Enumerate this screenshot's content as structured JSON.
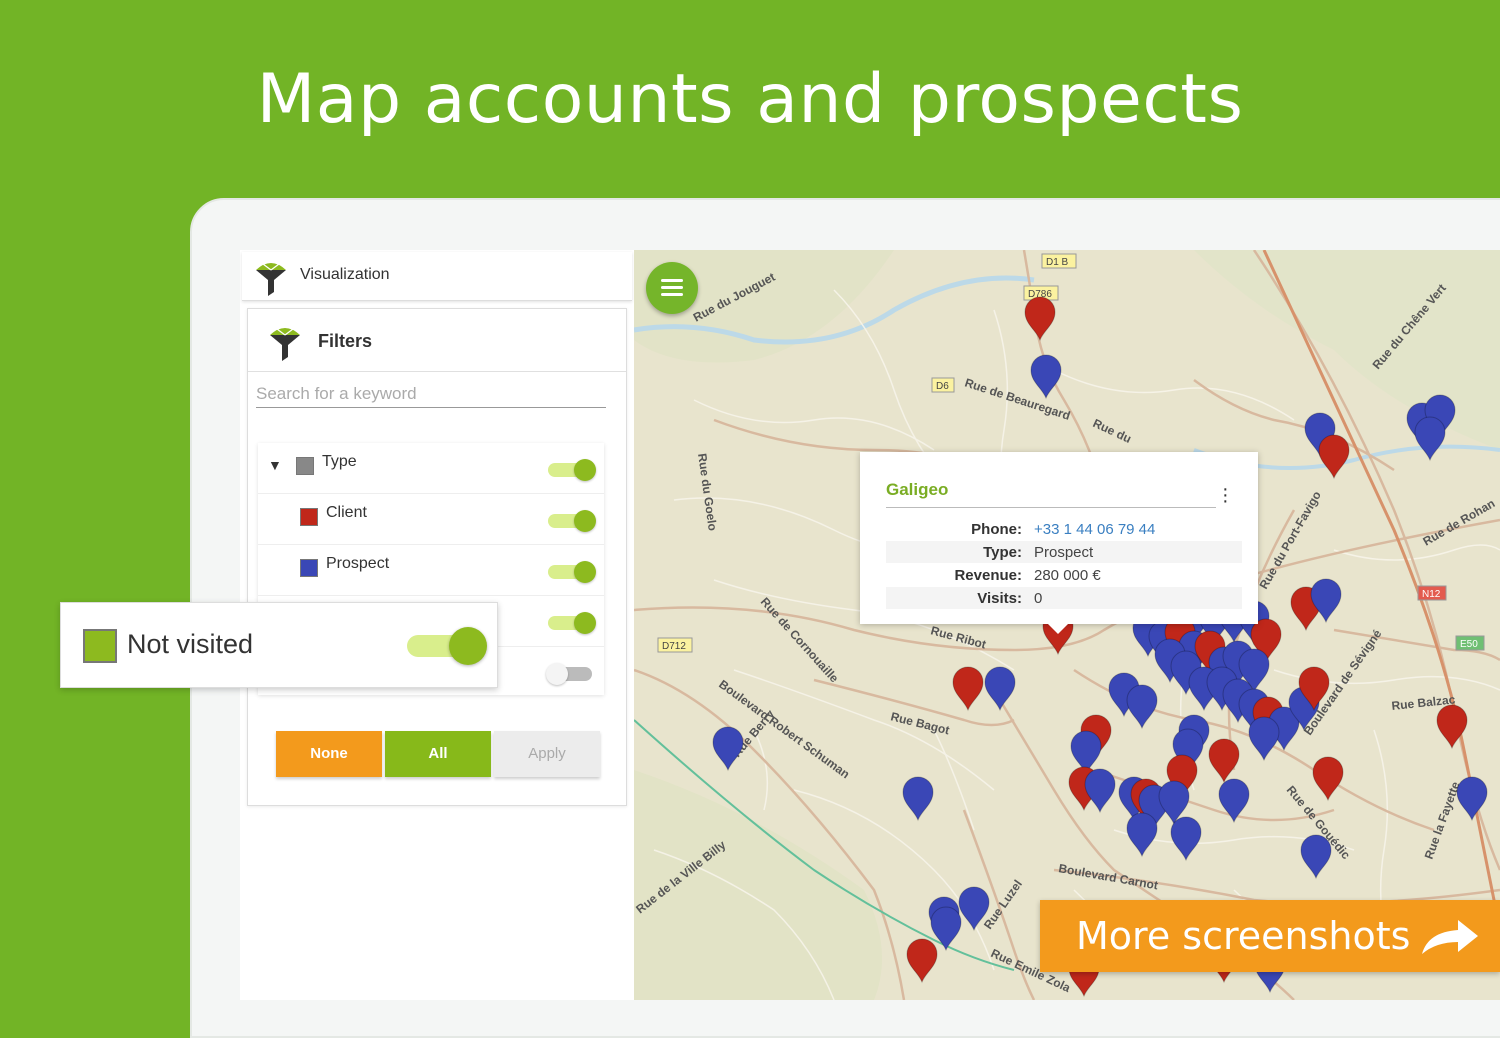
{
  "headline": "Map accounts and prospects",
  "sidebar": {
    "panel_title": "Visualization",
    "filters_title": "Filters",
    "search_placeholder": "Search for a keyword",
    "tree": [
      {
        "label": "Type",
        "color": "#888888",
        "enabled": true
      },
      {
        "label": "Client",
        "color": "#c0271a",
        "enabled": true
      },
      {
        "label": "Prospect",
        "color": "#3a47b6",
        "enabled": true
      },
      {
        "label": "",
        "enabled": true
      },
      {
        "label": "",
        "enabled": false
      }
    ],
    "buttons": {
      "none": "None",
      "all": "All",
      "apply": "Apply"
    }
  },
  "popup": {
    "title": "Galigeo",
    "fields": [
      {
        "key": "Phone:",
        "value": "+33 1 44 06 79 44"
      },
      {
        "key": "Type:",
        "value": "Prospect"
      },
      {
        "key": "Revenue:",
        "value": "280 000 €"
      },
      {
        "key": "Visits:",
        "value": "0"
      }
    ]
  },
  "callout": {
    "label": "Not visited",
    "color": "#8dba1f",
    "enabled": true
  },
  "cta": {
    "label": "More screenshots"
  },
  "map": {
    "street_labels": [
      "Rue du Jouguet",
      "Rue de Beauregard",
      "Rue du Goelo",
      "Rue de Cornouaille",
      "Boulevard Robert Schuman",
      "Rue Bagot",
      "Rue Balzac",
      "Rue du Port-Favigo",
      "Rue du Chêne Vert",
      "Rue de Rohan",
      "Boulevard Carnot",
      "Rue Luzel",
      "Rue de la Ville Billy",
      "Rue de Gouédic",
      "Rue la Fayette",
      "Boulevard de Sévigné",
      "Rue Emile Zola",
      "Rue Berry",
      "Rue Ribot",
      "Rue du"
    ],
    "road_badges": [
      "D1 B",
      "D786",
      "D6",
      "D712",
      "N12",
      "E50"
    ],
    "colors": {
      "client": "#c0271a",
      "prospect": "#3a47b6",
      "accent": "#72b426"
    }
  }
}
